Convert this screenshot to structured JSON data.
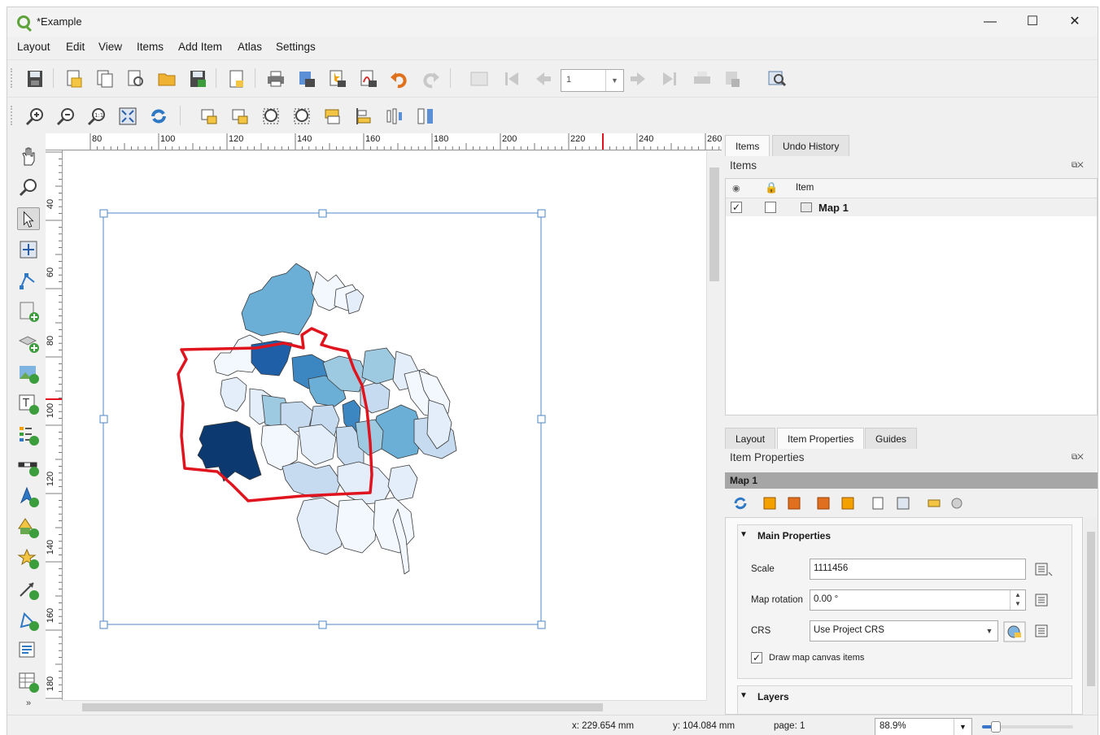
{
  "window": {
    "title": "*Example",
    "minimize": "—",
    "maximize": "☐",
    "close": "✕"
  },
  "menu": [
    "Layout",
    "Edit",
    "View",
    "Items",
    "Add Item",
    "Atlas",
    "Settings"
  ],
  "toolbar1": {
    "page_field_value": "1",
    "icons": [
      "save-layout-icon",
      "new-layout-icon",
      "duplicate-layout-icon",
      "layout-manager-icon",
      "open-template-icon",
      "save-template-icon",
      "page-setup-icon",
      "print-icon",
      "export-image-icon",
      "export-svg-icon",
      "export-pdf-icon",
      "undo-icon",
      "redo-icon",
      "atlas-preview-icon",
      "first-feature-icon",
      "previous-feature-icon",
      "next-feature-icon",
      "last-feature-icon",
      "print-atlas-icon",
      "export-atlas-icon",
      "atlas-settings-icon"
    ]
  },
  "toolbar2": {
    "icons": [
      "zoom-in-icon",
      "zoom-out-icon",
      "zoom-actual-icon",
      "zoom-full-icon",
      "refresh-icon",
      "lock-items-icon",
      "unlock-items-icon",
      "select-all-icon",
      "deselect-icon",
      "raise-items-icon",
      "align-left-icon",
      "distribute-icon",
      "resize-icon"
    ]
  },
  "toolbox": [
    "pan-icon",
    "zoom-tool-icon",
    "select-move-icon",
    "move-content-icon",
    "edit-nodes-icon",
    "add-map-icon",
    "add-3d-map-icon",
    "add-picture-icon",
    "add-label-icon",
    "add-legend-icon",
    "add-scalebar-icon",
    "add-north-arrow-icon",
    "add-shape-icon",
    "add-marker-icon",
    "add-arrow-icon",
    "add-node-item-icon",
    "add-html-icon",
    "add-attribute-table-icon",
    "more-tools-icon"
  ],
  "ruler_h": {
    "labels": [
      "80",
      "100",
      "120",
      "140",
      "160",
      "180",
      "200",
      "220",
      "240",
      "260"
    ]
  },
  "ruler_v": {
    "labels": [
      "40",
      "60",
      "80",
      "100",
      "120",
      "140",
      "160",
      "180"
    ]
  },
  "top_dock": {
    "tabs": [
      "Items",
      "Undo History"
    ],
    "panel_title": "Items",
    "columns": {
      "visible": "",
      "lock": "",
      "item": "Item"
    },
    "rows": [
      {
        "visible": "✓",
        "locked": "",
        "name": "Map 1"
      }
    ]
  },
  "bottom_dock": {
    "tabs": [
      "Layout",
      "Item Properties",
      "Guides"
    ],
    "panel_title": "Item Properties",
    "selected_item": "Map 1",
    "main_properties": {
      "title": "Main Properties",
      "scale_label": "Scale",
      "scale_value": "1111456",
      "rotation_label": "Map rotation",
      "rotation_value": "0.00 °",
      "crs_label": "CRS",
      "crs_value": "Use Project CRS",
      "draw_items_label": "Draw map canvas items",
      "draw_items_checked": "✓"
    },
    "layers_title": "Layers"
  },
  "status": {
    "x": "x: 229.654 mm",
    "y": "y: 104.084 mm",
    "page": "page: 1",
    "zoom": "88.9%",
    "zoom_fraction": 0.15
  },
  "colors": {
    "accent": "#3a76c9",
    "atlas_outline": "#e0141e",
    "choropleth": [
      "#f3f8fe",
      "#e3eefa",
      "#c6dbef",
      "#9ecae1",
      "#6baed6",
      "#3c86c2",
      "#1f5fa8",
      "#0b3970"
    ]
  }
}
